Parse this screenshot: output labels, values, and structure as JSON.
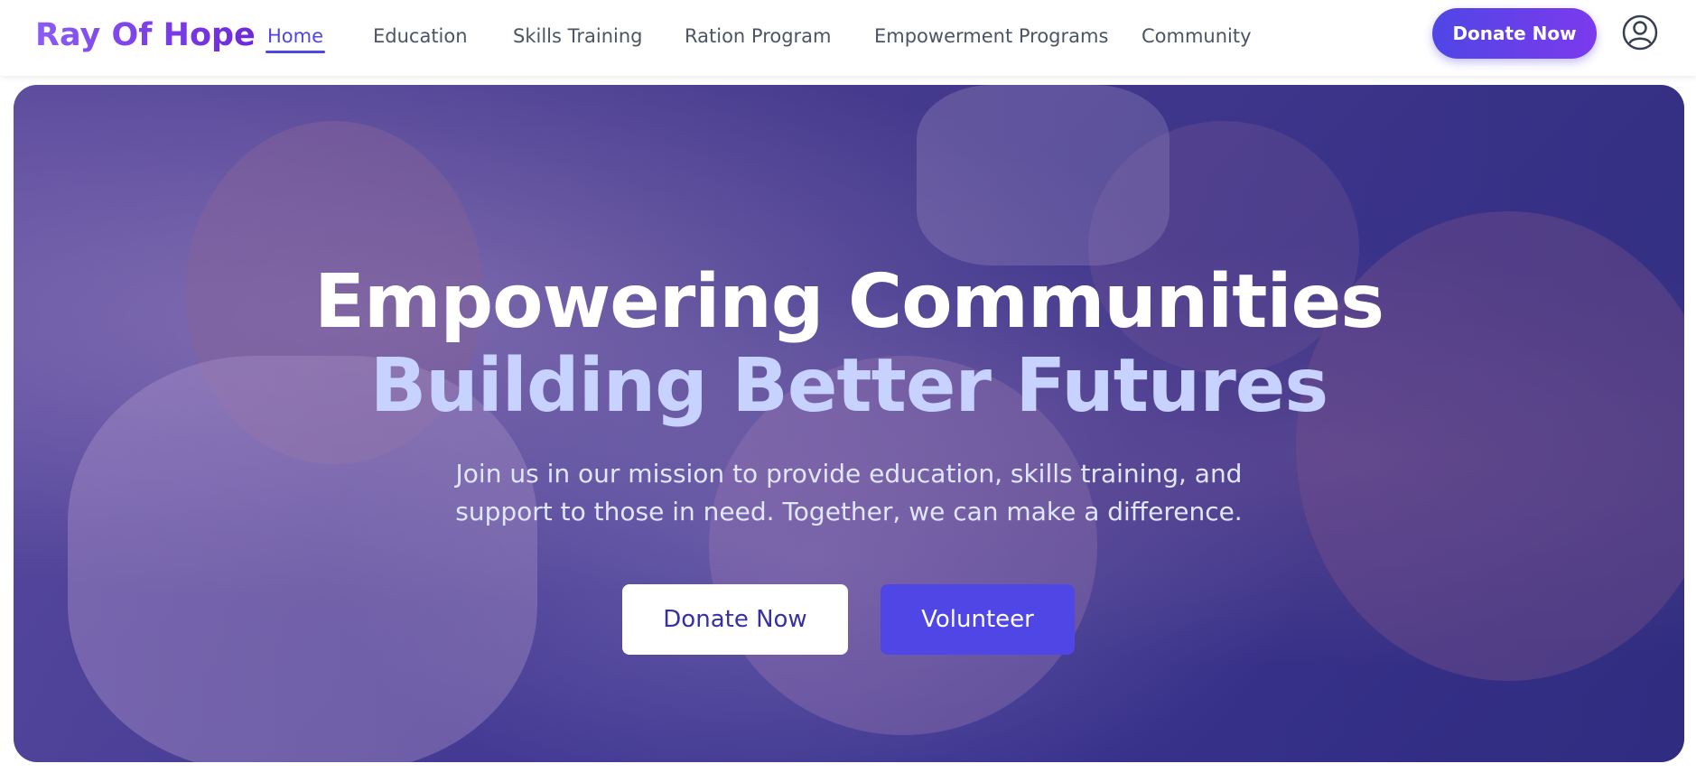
{
  "nav": {
    "brand": "Ray Of Hope",
    "links": [
      {
        "label": "Home",
        "active": true
      },
      {
        "label": "Education",
        "active": false
      },
      {
        "label": "Skills Training",
        "active": false
      },
      {
        "label": "Ration Program",
        "active": false
      },
      {
        "label": "Empowerment Programs",
        "active": false
      },
      {
        "label": "Community",
        "active": false
      }
    ],
    "donate_label": "Donate Now",
    "user_icon": "user-circle-icon"
  },
  "hero": {
    "title_line1": "Empowering Communities",
    "title_line2": "Building Better Futures",
    "subtitle": "Join us in our mission to provide education, skills training, and support to those in need. Together, we can make a difference.",
    "donate_label": "Donate Now",
    "volunteer_label": "Volunteer"
  },
  "colors": {
    "accent": "#4f46e5",
    "brand_gradient_start": "#8b5cf6",
    "brand_gradient_end": "#6d28d9",
    "title_highlight": "#c7d2fe"
  }
}
